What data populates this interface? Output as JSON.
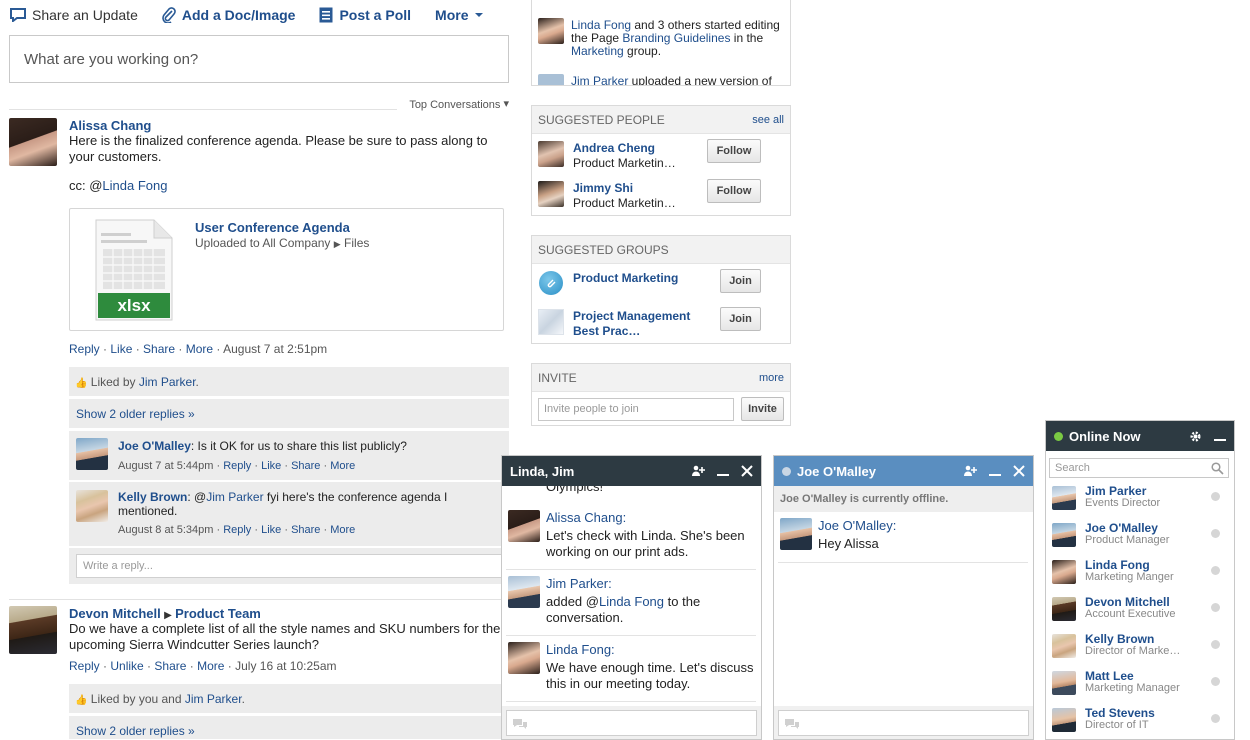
{
  "composer": {
    "tabs": [
      "Share an Update",
      "Add a Doc/Image",
      "Post a Poll",
      "More"
    ],
    "placeholder": "What are you working on?",
    "sort_label": "Top Conversations"
  },
  "post1": {
    "author": "Alissa Chang",
    "body": "Here is the finalized conference agenda. Please be sure to pass along to your customers.",
    "cc_prefix": "cc: @",
    "cc_name": "Linda Fong",
    "attachment": {
      "title": "User Conference Agenda",
      "sub_prefix": "Uploaded to All Company",
      "sub_suffix": "Files",
      "file_type": "xlsx"
    },
    "actions": [
      "Reply",
      "Like",
      "Share",
      "More"
    ],
    "timestamp": "August 7 at 2:51pm",
    "liked_prefix": "Liked by",
    "liked_by": "Jim Parker",
    "older_replies": "Show 2 older replies »",
    "replies": [
      {
        "author": "Joe O'Malley",
        "text": ": Is it OK for us to share this list publicly?",
        "time": "August 7 at 5:44pm"
      },
      {
        "author": "Kelly Brown",
        "text_prefix": ": @",
        "mention": "Jim Parker",
        "text": " fyi here's the conference agenda I mentioned.",
        "time": "August 8 at 5:34pm"
      }
    ],
    "reply_actions": [
      "Reply",
      "Like",
      "Share",
      "More"
    ],
    "write_reply": "Write a reply..."
  },
  "post2": {
    "author": "Devon Mitchell",
    "group": "Product Team",
    "body": "Do we have a complete list of all the style names and SKU numbers for the upcoming Sierra Windcutter Series launch?",
    "actions": [
      "Reply",
      "Unlike",
      "Share",
      "More"
    ],
    "timestamp": "July 16 at 10:25am",
    "liked_prefix": "Liked by you and",
    "liked_by": "Jim Parker",
    "older_replies": "Show 2 older replies »"
  },
  "activity": {
    "item1_name": "Linda Fong",
    "item1_mid": " and 3 others started editing the Page ",
    "item1_page": "Branding Guidelines",
    "item1_in": " in the ",
    "item1_group": "Marketing",
    "item1_end": " group.",
    "item2_name": "Jim Parker",
    "item2_text": " uploaded a new version of"
  },
  "suggested_people": {
    "title": "SUGGESTED PEOPLE",
    "see_all": "see all",
    "people": [
      {
        "name": "Andrea Cheng",
        "sub": "Product Marketin…",
        "button": "Follow"
      },
      {
        "name": "Jimmy Shi",
        "sub": "Product Marketin…",
        "button": "Follow"
      }
    ]
  },
  "suggested_groups": {
    "title": "SUGGESTED GROUPS",
    "groups": [
      {
        "name": "Product Marketing",
        "button": "Join"
      },
      {
        "name_line1": "Project Management",
        "name_line2": "Best Prac…",
        "button": "Join"
      }
    ]
  },
  "invite": {
    "title": "INVITE",
    "more": "more",
    "placeholder": "Invite people to join",
    "button": "Invite"
  },
  "chat1": {
    "title": "Linda, Jim",
    "partial": "Olympics!",
    "messages": [
      {
        "name": "Alissa Chang:",
        "text": "Let's check with Linda. She's been working on our print ads."
      },
      {
        "name": "Jim Parker:",
        "text_prefix": "added @",
        "mention": "Linda Fong",
        "text": " to the conversation."
      },
      {
        "name": "Linda Fong:",
        "text": "We have enough time. Let's discuss this in our meeting today."
      }
    ]
  },
  "chat2": {
    "title": "Joe O'Malley",
    "offline": "Joe O'Malley is currently offline.",
    "messages": [
      {
        "name": "Joe O'Malley:",
        "text": "Hey Alissa"
      }
    ]
  },
  "online_now": {
    "title": "Online Now",
    "search_placeholder": "Search",
    "people": [
      {
        "name": "Jim Parker",
        "sub": "Events Director"
      },
      {
        "name": "Joe O'Malley",
        "sub": "Product Manager"
      },
      {
        "name": "Linda Fong",
        "sub": "Marketing Manger"
      },
      {
        "name": "Devon Mitchell",
        "sub": "Account Executive"
      },
      {
        "name": "Kelly Brown",
        "sub": "Director of Marke…"
      },
      {
        "name": "Matt Lee",
        "sub": "Marketing Manager"
      },
      {
        "name": "Ted Stevens",
        "sub": "Director of IT"
      }
    ]
  },
  "colors": {
    "link": "#1f4e8c",
    "chat_head_dark": "#2d3a42",
    "chat_head_blue": "#5a8ec0",
    "online_dot": "#7ac943",
    "xlsx_green": "#2e8b3d"
  }
}
